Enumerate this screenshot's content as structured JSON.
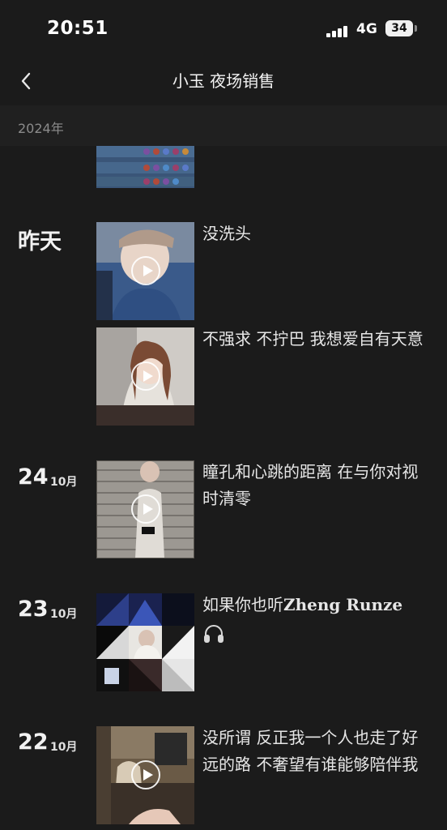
{
  "status_bar": {
    "time": "20:51",
    "network": "4G",
    "battery": "34"
  },
  "nav": {
    "title": "小玉 夜场销售"
  },
  "year_header": "2024年",
  "posts": [
    {
      "date": "昨天",
      "items": [
        {
          "type": "video",
          "caption": "没洗头"
        },
        {
          "type": "video",
          "caption": "不强求 不拧巴 我想爱自有天意"
        }
      ]
    },
    {
      "day": "24",
      "month": "10月",
      "items": [
        {
          "type": "video",
          "caption": "瞳孔和心跳的距离 在与你对视时清零"
        }
      ]
    },
    {
      "day": "23",
      "month": "10月",
      "items": [
        {
          "type": "image-grid",
          "caption_prefix": "如果你也听",
          "caption_artist": "Zheng Runze"
        }
      ]
    },
    {
      "day": "22",
      "month": "10月",
      "items": [
        {
          "type": "video",
          "caption": "没所谓 反正我一个人也走了好远的路 不奢望有谁能够陪伴我"
        }
      ]
    }
  ],
  "colors": {
    "background": "#1b1b1b",
    "year_bar": "#202020",
    "text": "#e8e8e8"
  }
}
